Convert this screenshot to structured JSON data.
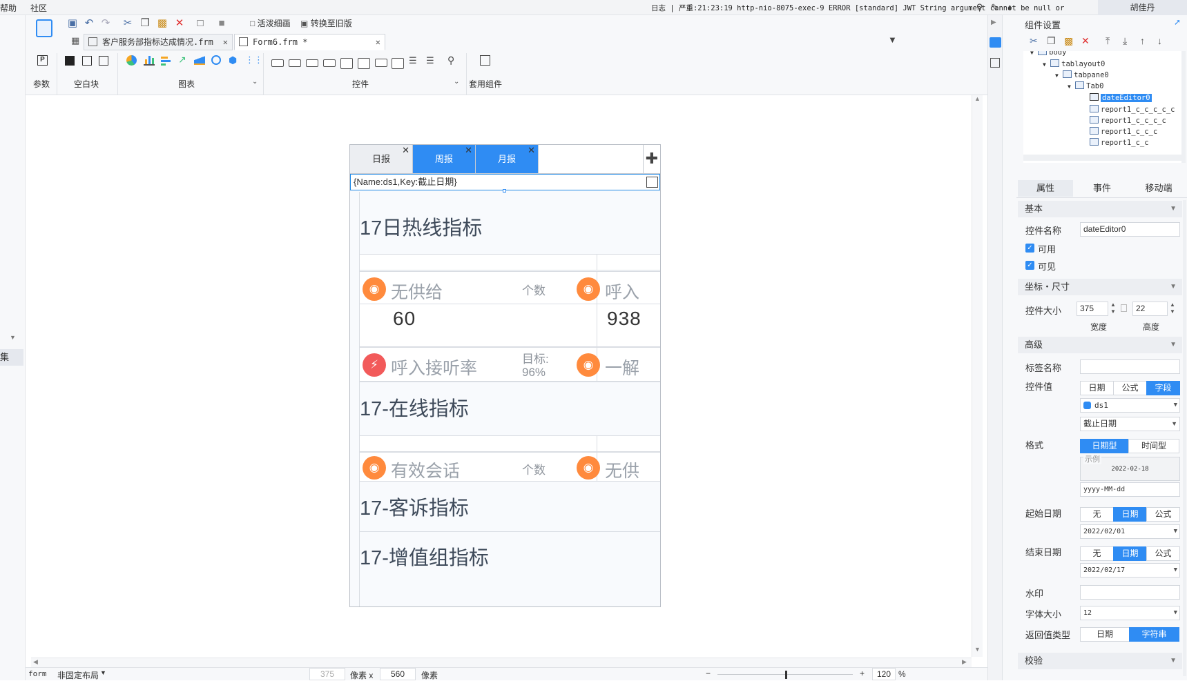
{
  "topbar": {
    "menu_help": "帮助",
    "menu_community": "社区",
    "log_text": "日志 | 严重:21:23:19 http-nio-8075-exec-9 ERROR [standard] JWT String argument cannot be null or",
    "user": "胡佳丹"
  },
  "toolbar": {
    "btn_live_preview": "活泼细画",
    "btn_convert_old": "转换至旧版",
    "tabs": [
      {
        "label": "客户服务部指标达成情况.frm"
      },
      {
        "label": "Form6.frm *"
      }
    ],
    "groups": {
      "param": "参数",
      "blank": "空白块",
      "chart": "图表",
      "widget": "控件",
      "suite": "套用组件"
    },
    "param_icon_text": "P"
  },
  "left": {
    "collection_label": "集"
  },
  "form": {
    "tabs": [
      "日报",
      "周报",
      "月报"
    ],
    "date_value": "{Name:ds1,Key:截止日期}",
    "sections": {
      "s1": "17日热线指标",
      "s2": "17-在线指标",
      "s3": "17-客诉指标",
      "s4": "17-增值组指标"
    },
    "metrics": {
      "m1_label": "无供给",
      "m1_unit": "个数",
      "m1_value": "60",
      "m2_label": "呼入",
      "m2_value": "938",
      "m3_label": "呼入接听率",
      "m3_target_label": "目标:",
      "m3_target_value": "96%",
      "m4_label": "一解",
      "m5_label": "有效会话",
      "m5_unit": "个数",
      "m6_label": "无供"
    }
  },
  "statusbar": {
    "mode": "form",
    "layout": "非固定布局",
    "width": "375",
    "px_x": "像素 x",
    "height": "560",
    "px": "像素",
    "zoom": "120",
    "pct": "%"
  },
  "panel": {
    "title": "组件设置",
    "tree": [
      "body",
      "tablayout0",
      "tabpane0",
      "Tab0",
      "dateEditor0",
      "report1_c_c_c_c_c",
      "report1_c_c_c_c",
      "report1_c_c_c",
      "report1_c_c"
    ],
    "tabs": [
      "属性",
      "事件",
      "移动端"
    ],
    "basic": "基本",
    "ctrl_name_label": "控件名称",
    "ctrl_name_value": "dateEditor0",
    "enabled": "可用",
    "visible": "可见",
    "coord_size": "坐标・尺寸",
    "ctrl_size_label": "控件大小",
    "width_value": "375",
    "height_value": "22",
    "width_label": "宽度",
    "height_label": "高度",
    "advanced": "高级",
    "tag_name_label": "标签名称",
    "ctrl_value_label": "控件值",
    "value_modes": [
      "日期",
      "公式",
      "字段"
    ],
    "dataset": "ds1",
    "field": "截止日期",
    "format_label": "格式",
    "format_modes": [
      "日期型",
      "时间型"
    ],
    "example_label": "示例",
    "example_value": "2022-02-18",
    "format_pattern": "yyyy-MM-dd",
    "start_date_label": "起始日期",
    "start_modes": [
      "无",
      "日期",
      "公式"
    ],
    "start_value": "2022/02/01",
    "end_date_label": "结束日期",
    "end_modes": [
      "无",
      "日期",
      "公式"
    ],
    "end_value": "2022/02/17",
    "watermark_label": "水印",
    "font_size_label": "字体大小",
    "font_size_value": "12",
    "return_type_label": "返回值类型",
    "return_modes": [
      "日期",
      "字符串"
    ],
    "validate": "校验"
  },
  "colors": {
    "accent": "#2f8cf3",
    "tab_active": "#2f8cf3",
    "orange": "#ff8a3d",
    "red": "#f25a5a"
  }
}
